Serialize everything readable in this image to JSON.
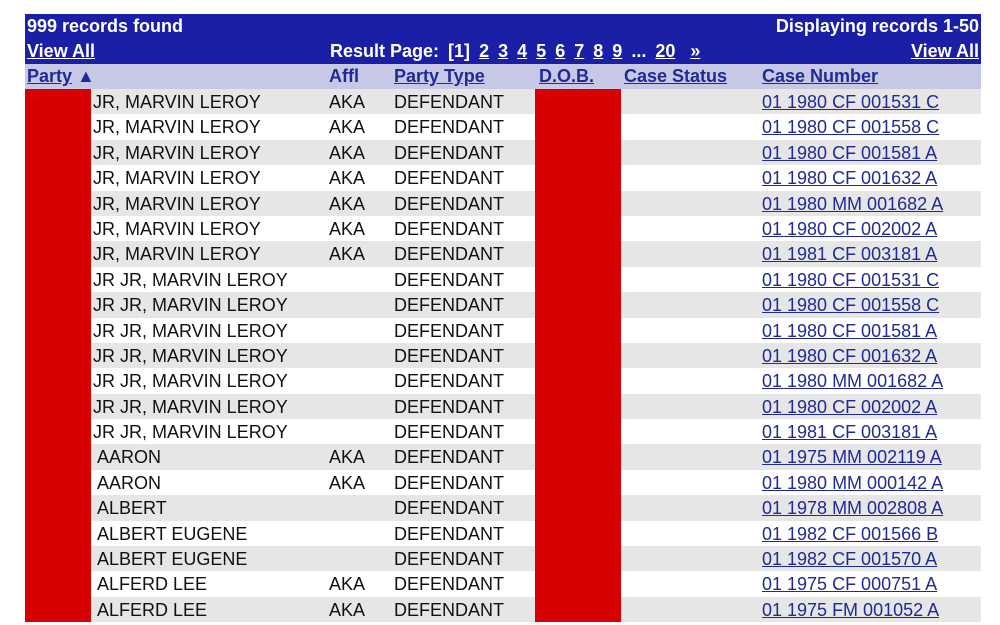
{
  "top": {
    "records_found": "999 records found",
    "displaying": "Displaying records 1-50",
    "view_all_left": "View All",
    "view_all_right": "View All",
    "pager_label": "Result Page:",
    "pages": [
      "[1]",
      "2",
      "3",
      "4",
      "5",
      "6",
      "7",
      "8",
      "9",
      "...",
      "20",
      "»"
    ]
  },
  "columns": {
    "party": "Party",
    "affl": "Affl",
    "party_type": "Party Type",
    "dob": "D.O.B.",
    "case_status": "Case Status",
    "case_number": "Case Number"
  },
  "rows": [
    {
      "party": "JR, MARVIN LEROY",
      "affl": "AKA",
      "type": "DEFENDANT",
      "case": "01 1980 CF 001531 C"
    },
    {
      "party": "JR, MARVIN LEROY",
      "affl": "AKA",
      "type": "DEFENDANT",
      "case": "01 1980 CF 001558 C"
    },
    {
      "party": "JR, MARVIN LEROY",
      "affl": "AKA",
      "type": "DEFENDANT",
      "case": "01 1980 CF 001581 A"
    },
    {
      "party": "JR, MARVIN LEROY",
      "affl": "AKA",
      "type": "DEFENDANT",
      "case": "01 1980 CF 001632 A"
    },
    {
      "party": "JR, MARVIN LEROY",
      "affl": "AKA",
      "type": "DEFENDANT",
      "case": "01 1980 MM 001682 A"
    },
    {
      "party": "JR, MARVIN LEROY",
      "affl": "AKA",
      "type": "DEFENDANT",
      "case": "01 1980 CF 002002 A"
    },
    {
      "party": "JR, MARVIN LEROY",
      "affl": "AKA",
      "type": "DEFENDANT",
      "case": "01 1981 CF 003181 A"
    },
    {
      "party": "JR JR, MARVIN LEROY",
      "affl": "",
      "type": "DEFENDANT",
      "case": "01 1980 CF 001531 C"
    },
    {
      "party": "JR JR, MARVIN LEROY",
      "affl": "",
      "type": "DEFENDANT",
      "case": "01 1980 CF 001558 C"
    },
    {
      "party": "JR JR, MARVIN LEROY",
      "affl": "",
      "type": "DEFENDANT",
      "case": "01 1980 CF 001581 A"
    },
    {
      "party": "JR JR, MARVIN LEROY",
      "affl": "",
      "type": "DEFENDANT",
      "case": "01 1980 CF 001632 A"
    },
    {
      "party": "JR JR, MARVIN LEROY",
      "affl": "",
      "type": "DEFENDANT",
      "case": "01 1980 MM 001682 A"
    },
    {
      "party": "JR JR, MARVIN LEROY",
      "affl": "",
      "type": "DEFENDANT",
      "case": "01 1980 CF 002002 A"
    },
    {
      "party": "JR JR, MARVIN LEROY",
      "affl": "",
      "type": "DEFENDANT",
      "case": "01 1981 CF 003181 A"
    },
    {
      "party": "AARON",
      "affl": "AKA",
      "type": "DEFENDANT",
      "case": "01 1975 MM 002119 A"
    },
    {
      "party": "AARON",
      "affl": "AKA",
      "type": "DEFENDANT",
      "case": "01 1980 MM 000142 A"
    },
    {
      "party": "ALBERT",
      "affl": "",
      "type": "DEFENDANT",
      "case": "01 1978 MM 002808 A"
    },
    {
      "party": "ALBERT EUGENE",
      "affl": "",
      "type": "DEFENDANT",
      "case": "01 1982 CF 001566 B"
    },
    {
      "party": "ALBERT EUGENE",
      "affl": "",
      "type": "DEFENDANT",
      "case": "01 1982 CF 001570 A"
    },
    {
      "party": "ALFERD LEE",
      "affl": "AKA",
      "type": "DEFENDANT",
      "case": "01 1975 CF 000751 A"
    },
    {
      "party": "ALFERD LEE",
      "affl": "AKA",
      "type": "DEFENDANT",
      "case": "01 1975 FM 001052 A"
    }
  ]
}
